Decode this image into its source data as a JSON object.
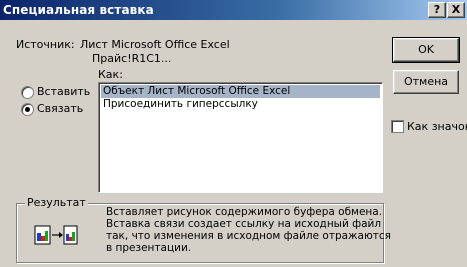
{
  "window": {
    "title": "Специальная вставка",
    "help_label": "?",
    "close_label": "X"
  },
  "source": {
    "label": "Источник:",
    "line1": "Лист Microsoft Office Excel",
    "line2": "Прайс!R1C1..."
  },
  "as_label": "Как:",
  "options": {
    "paste_label": "Вставить",
    "link_label": "Связать",
    "selected": "link"
  },
  "list": {
    "items": [
      "Объект Лист Microsoft Office Excel",
      "Присоединить гиперссылку"
    ],
    "selected_index": 0
  },
  "buttons": {
    "ok": "OK",
    "cancel": "Отмена"
  },
  "as_icon": {
    "label": "Как значок",
    "checked": false
  },
  "result": {
    "legend": "Результат",
    "lines": [
      "Вставляет рисунок содержимого буфера обмена.",
      "Вставка связи создает ссылку на исходный файл",
      "так, что изменения в исходном файле отражаются",
      "в презентации."
    ],
    "icon": "paste-link-icon"
  }
}
